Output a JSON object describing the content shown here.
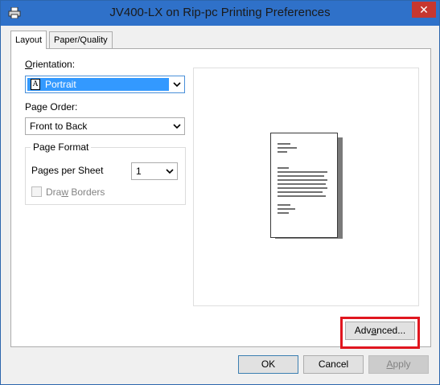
{
  "window": {
    "title": "JV400-LX on Rip-pc Printing Preferences",
    "close_glyph": "✕",
    "app_icon": "printer-icon"
  },
  "tabs": [
    {
      "label": "Layout",
      "active": true
    },
    {
      "label": "Paper/Quality",
      "active": false
    }
  ],
  "layout": {
    "orientation": {
      "label_mnemonic": "O",
      "label_rest": "rientation:",
      "value": "Portrait",
      "glyph": "A"
    },
    "page_order": {
      "label": "Page Order:",
      "value": "Front to Back"
    },
    "page_format": {
      "legend": "Page Format",
      "pages_per_sheet": {
        "label_pre": "Pages per Sheet",
        "value": "1"
      },
      "draw_borders": {
        "label_pre": "Dra",
        "label_mnemonic": "w",
        "label_post": " Borders",
        "checked": false,
        "enabled": false
      }
    }
  },
  "buttons": {
    "advanced_pre": "Adv",
    "advanced_mnemonic": "a",
    "advanced_post": "nced...",
    "ok": "OK",
    "cancel": "Cancel",
    "apply_mnemonic": "A",
    "apply_rest": "pply"
  },
  "colors": {
    "titlebar": "#2f71c9",
    "close": "#c7372f",
    "highlight": "#e0161f",
    "selection": "#3399ff"
  }
}
